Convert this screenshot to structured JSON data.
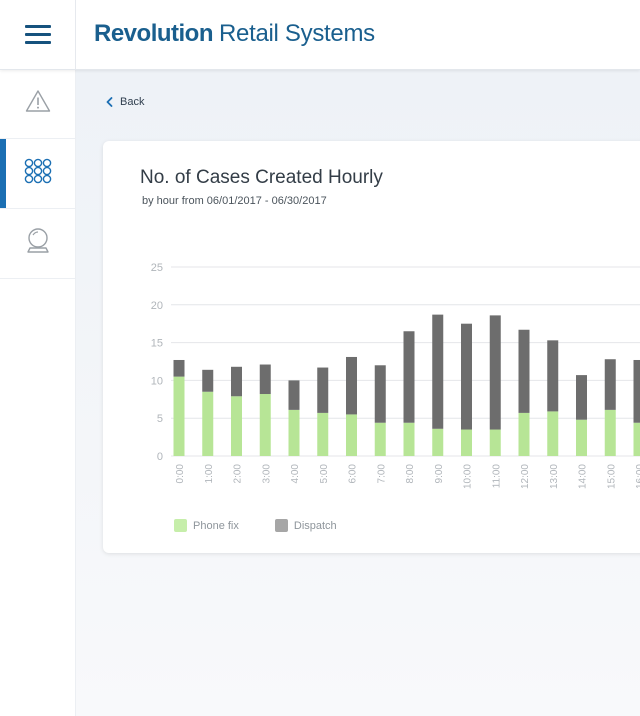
{
  "header": {
    "brand_strong": "Revolution",
    "brand_rest": "Retail Systems",
    "brand_color": "#1a5f8e"
  },
  "sidebar": {
    "items": [
      {
        "icon": "warning-icon",
        "active": false
      },
      {
        "icon": "grid-icon",
        "active": true
      },
      {
        "icon": "crystal-ball-icon",
        "active": false
      }
    ],
    "accent": "#1b6fb3"
  },
  "nav": {
    "back_label": "Back"
  },
  "card": {
    "title": "No. of Cases Created Hourly",
    "subtitle": "by hour from 06/01/2017 - 06/30/2017"
  },
  "chart_data": {
    "type": "bar",
    "stacked": true,
    "categories": [
      "0:00",
      "1:00",
      "2:00",
      "3:00",
      "4:00",
      "5:00",
      "6:00",
      "7:00",
      "8:00",
      "9:00",
      "10:00",
      "11:00",
      "12:00",
      "13:00",
      "14:00",
      "15:00",
      "16:00"
    ],
    "series": [
      {
        "name": "Phone fix",
        "color": "#b7e596",
        "values": [
          10.5,
          8.5,
          7.9,
          8.2,
          6.1,
          5.7,
          5.5,
          4.4,
          4.4,
          3.6,
          3.5,
          3.5,
          5.7,
          5.9,
          4.8,
          6.1,
          4.4
        ]
      },
      {
        "name": "Dispatch",
        "color": "#6d6d6d",
        "values": [
          2.2,
          2.9,
          3.9,
          3.9,
          3.9,
          6.0,
          7.6,
          7.6,
          12.1,
          15.1,
          14.0,
          15.1,
          11.0,
          9.4,
          5.9,
          6.7,
          8.3
        ]
      }
    ],
    "ylim": [
      0,
      25
    ],
    "yticks": [
      0,
      5,
      10,
      15,
      20,
      25
    ],
    "grid": true,
    "legend_position": "bottom-left",
    "xlabel": "",
    "ylabel": ""
  }
}
